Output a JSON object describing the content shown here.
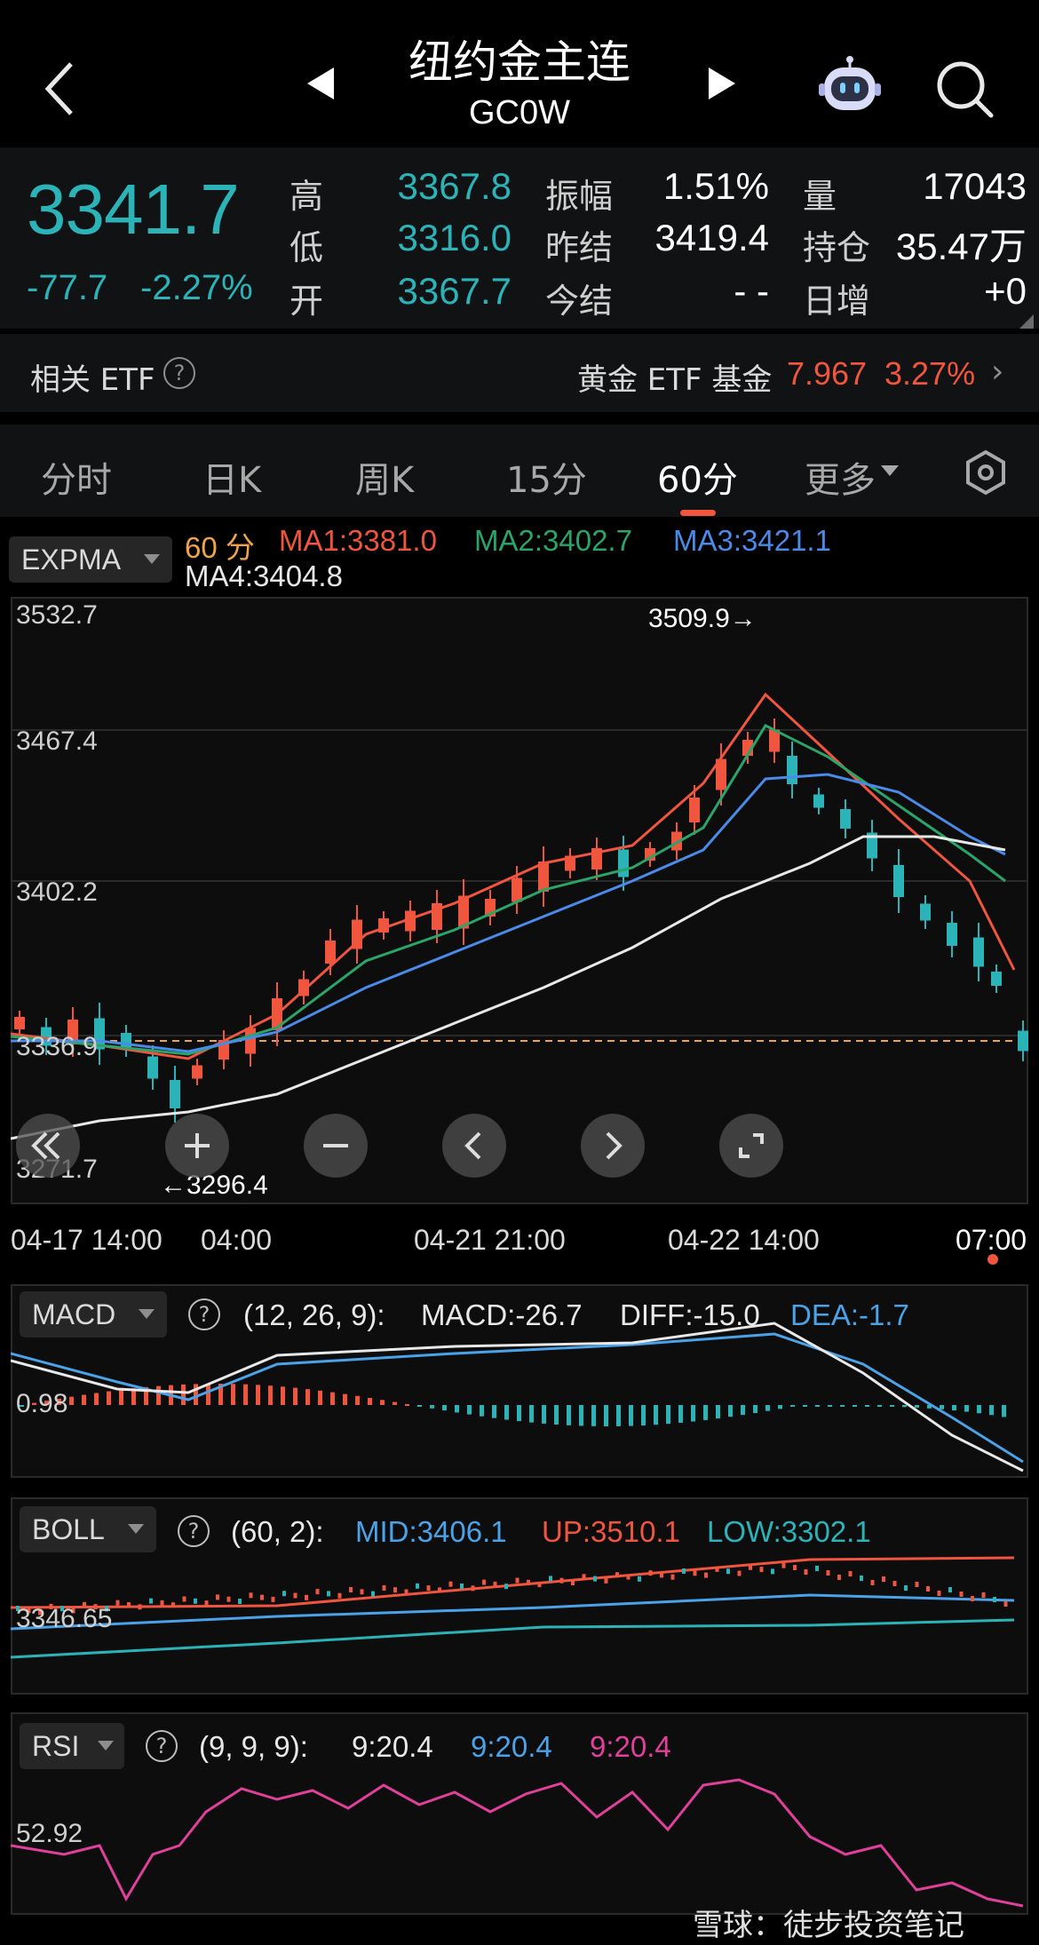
{
  "header": {
    "title": "纽约金主连",
    "subtitle": "GC0W"
  },
  "quote": {
    "last": "3341.7",
    "change": "-77.7",
    "change_pct": "-2.27%",
    "high_label": "高",
    "high": "3367.8",
    "low_label": "低",
    "low": "3316.0",
    "open_label": "开",
    "open": "3367.7",
    "amp_label": "振幅",
    "amp": "1.51%",
    "prev_label": "昨结",
    "prev": "3419.4",
    "today_label": "今结",
    "today": "- -",
    "vol_label": "量",
    "vol": "17043",
    "oi_label": "持仓",
    "oi": "35.47万",
    "daily_label": "日增",
    "daily": "+0"
  },
  "etf": {
    "label": "相关 ETF",
    "help": "?",
    "name": "黄金 ETF 基金",
    "price": "7.967",
    "pct": "3.27%",
    "arrow": "›"
  },
  "tabs": [
    "分时",
    "日K",
    "周K",
    "15分",
    "60分",
    "更多"
  ],
  "active_tab": "60分",
  "main": {
    "indicator": "EXPMA",
    "period": "60 分",
    "ma1": "MA1:3381.0",
    "ma2": "MA2:3402.7",
    "ma3": "MA3:3421.1",
    "ma4": "MA4:3404.8",
    "y_labels": [
      "3532.7",
      "3467.4",
      "3402.2",
      "3336.9",
      "3271.7"
    ],
    "high_mark": "3509.9→",
    "low_mark": "←3296.4",
    "x_labels": [
      "04-17 14:00",
      "04:00",
      "04-21 21:00",
      "04-22 14:00",
      "07:00"
    ],
    "colors": {
      "ma1": "#f0553e",
      "ma2": "#2aa56a",
      "ma3": "#4a8ae8",
      "ma4": "#e8e8e8",
      "up": "#f0553e",
      "down": "#2bb3b8"
    }
  },
  "macd": {
    "name": "MACD",
    "help": "?",
    "params": "(12, 26, 9):",
    "macd": "MACD:-26.7",
    "diff": "DIFF:-15.0",
    "dea": "DEA:-1.7",
    "ylabel": "0.98"
  },
  "boll": {
    "name": "BOLL",
    "help": "?",
    "params": "(60, 2):",
    "mid": "MID:3406.1",
    "up": "UP:3510.1",
    "low": "LOW:3302.1",
    "ylabel": "3346.65"
  },
  "rsi": {
    "name": "RSI",
    "help": "?",
    "params": "(9, 9, 9):",
    "r1": "9:20.4",
    "r2": "9:20.4",
    "r3": "9:20.4",
    "ylabel": "52.92"
  },
  "watermark": "雪球：徒步投资笔记"
}
